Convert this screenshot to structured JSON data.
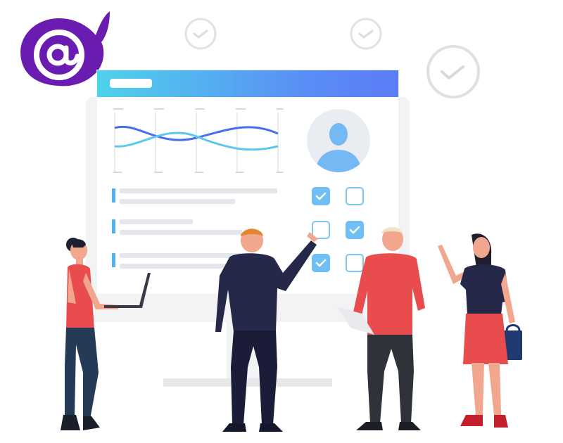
{
  "logo": {
    "name": "blazor-logo",
    "symbol": "@"
  },
  "colors": {
    "logo_purple": "#6a1cb0",
    "header_gradient_start": "#4ed2ea",
    "header_gradient_end": "#5b7cf7",
    "checkbox_blue": "#6ec0f4",
    "wave_dark": "#4a6cf0",
    "wave_light": "#5cc8ee"
  },
  "decorative_icons": [
    "check-circle-icon",
    "check-circle-icon",
    "check-circle-icon"
  ],
  "checklist": [
    {
      "left_checked": true,
      "right_checked": false
    },
    {
      "left_checked": false,
      "right_checked": true
    },
    {
      "left_checked": true,
      "right_checked": false
    }
  ]
}
